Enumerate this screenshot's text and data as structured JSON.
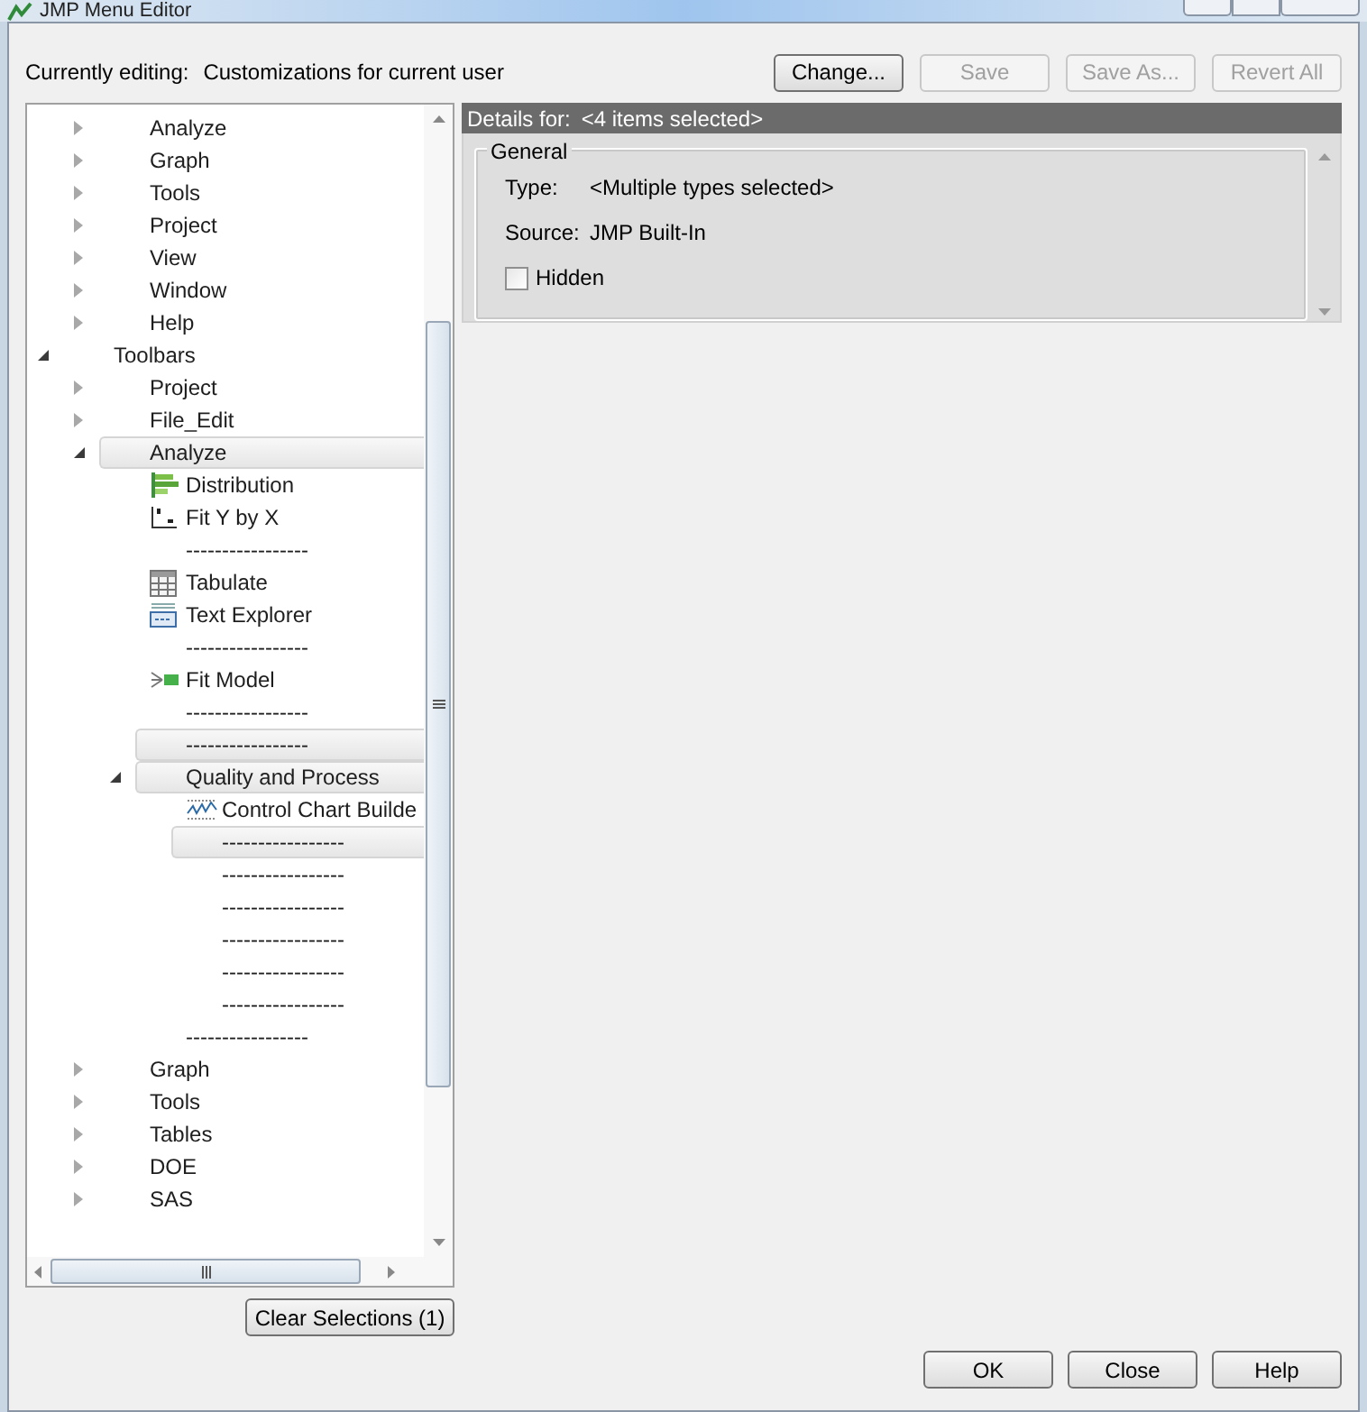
{
  "window": {
    "title": "JMP Menu Editor"
  },
  "header": {
    "label": "Currently editing:",
    "value": "Customizations for current user",
    "buttons": [
      {
        "label": "Change...",
        "disabled": false
      },
      {
        "label": "Save",
        "disabled": true
      },
      {
        "label": "Save As...",
        "disabled": true
      },
      {
        "label": "Revert All",
        "disabled": true
      }
    ]
  },
  "tree": {
    "items": [
      {
        "kind": "offscreen",
        "children": [
          {
            "kind": "folder",
            "label": "Analyze",
            "expanded": false,
            "selected": false
          },
          {
            "kind": "folder",
            "label": "Graph",
            "expanded": false,
            "selected": false
          },
          {
            "kind": "folder",
            "label": "Tools",
            "expanded": false,
            "selected": false
          },
          {
            "kind": "folder",
            "label": "Project",
            "expanded": false,
            "selected": false
          },
          {
            "kind": "folder",
            "label": "View",
            "expanded": false,
            "selected": false
          },
          {
            "kind": "folder",
            "label": "Window",
            "expanded": false,
            "selected": false
          },
          {
            "kind": "folder",
            "label": "Help",
            "expanded": false,
            "selected": false
          }
        ]
      },
      {
        "kind": "folder",
        "label": "Toolbars",
        "expanded": true,
        "selected": false,
        "children": [
          {
            "kind": "folder",
            "label": "Project",
            "expanded": false,
            "selected": false
          },
          {
            "kind": "folder",
            "label": "File_Edit",
            "expanded": false,
            "selected": false
          },
          {
            "kind": "folder",
            "label": "Analyze",
            "expanded": true,
            "selected": true,
            "children": [
              {
                "kind": "histogram",
                "label": "Distribution",
                "selected": false
              },
              {
                "kind": "scatter",
                "label": "Fit Y by X",
                "selected": false
              },
              {
                "kind": "separator",
                "label": "-----------------",
                "selected": false
              },
              {
                "kind": "table",
                "label": "Tabulate",
                "selected": false
              },
              {
                "kind": "text",
                "label": "Text Explorer",
                "selected": false
              },
              {
                "kind": "separator",
                "label": "-----------------",
                "selected": false
              },
              {
                "kind": "model",
                "label": "Fit Model",
                "selected": false
              },
              {
                "kind": "separator",
                "label": "-----------------",
                "selected": false
              },
              {
                "kind": "separator",
                "label": "-----------------",
                "selected": true
              },
              {
                "kind": "folder",
                "label": "Quality and Process",
                "expanded": true,
                "selected": true,
                "children": [
                  {
                    "kind": "chart",
                    "label": "Control Chart Builde",
                    "selected": false
                  },
                  {
                    "kind": "separator",
                    "label": "-----------------",
                    "selected": true
                  },
                  {
                    "kind": "separator",
                    "label": "-----------------",
                    "selected": false
                  },
                  {
                    "kind": "separator",
                    "label": "-----------------",
                    "selected": false
                  },
                  {
                    "kind": "separator",
                    "label": "-----------------",
                    "selected": false
                  },
                  {
                    "kind": "separator",
                    "label": "-----------------",
                    "selected": false
                  },
                  {
                    "kind": "separator",
                    "label": "-----------------",
                    "selected": false
                  }
                ]
              },
              {
                "kind": "separator",
                "label": "-----------------",
                "selected": false
              }
            ]
          },
          {
            "kind": "folder",
            "label": "Graph",
            "expanded": false,
            "selected": false
          },
          {
            "kind": "folder",
            "label": "Tools",
            "expanded": false,
            "selected": false
          },
          {
            "kind": "folder",
            "label": "Tables",
            "expanded": false,
            "selected": false
          },
          {
            "kind": "folder",
            "label": "DOE",
            "expanded": false,
            "selected": false
          },
          {
            "kind": "folder",
            "label": "SAS",
            "expanded": false,
            "selected": false
          }
        ]
      }
    ]
  },
  "clear_button": "Clear Selections (1)",
  "details": {
    "title_label": "Details for:",
    "title_value": "<4 items selected>",
    "group": "General",
    "fields": [
      {
        "label": "Type:",
        "value": "<Multiple types selected>"
      },
      {
        "label": "Source:",
        "value": "JMP Built-In"
      }
    ],
    "hidden": {
      "label": "Hidden",
      "checked": false
    }
  },
  "footer_buttons": [
    "OK",
    "Close",
    "Help"
  ]
}
